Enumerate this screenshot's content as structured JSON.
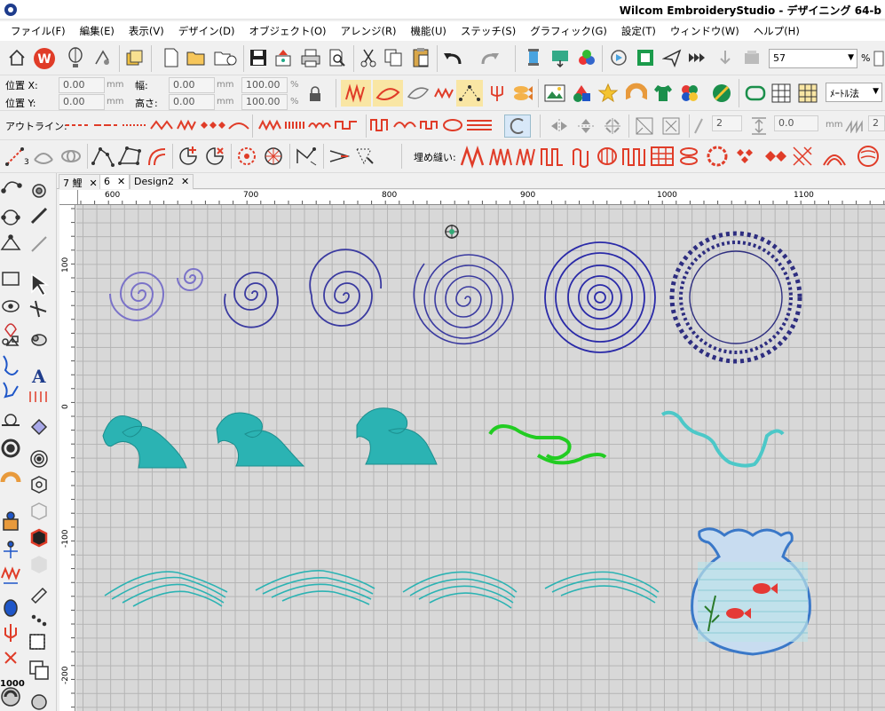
{
  "window": {
    "title": "Wilcom EmbroideryStudio - デザイニング 64-b"
  },
  "menu": [
    "ファイル(F)",
    "編集(E)",
    "表示(V)",
    "デザイン(D)",
    "オブジェクト(O)",
    "アレンジ(R)",
    "機能(U)",
    "ステッチ(S)",
    "グラフィック(G)",
    "設定(T)",
    "ウィンドウ(W)",
    "ヘルプ(H)"
  ],
  "toolbar": {
    "zoom_value": "57",
    "zoom_unit": "%",
    "measure_combo": "ﾒｰﾄﾙ法"
  },
  "position_bar": {
    "pos_x_label": "位置 X:",
    "pos_x_value": "0.00",
    "pos_x_unit": "mm",
    "pos_y_label": "位置 Y:",
    "pos_y_value": "0.00",
    "pos_y_unit": "mm",
    "width_label": "幅:",
    "width_value": "0.00",
    "width_unit": "mm",
    "height_label": "高さ:",
    "height_value": "0.00",
    "height_unit": "mm",
    "width_pct": "100.00",
    "height_pct": "100.00",
    "pct_unit": "%"
  },
  "outline_bar": {
    "label": "アウトライン:",
    "spin1": "2",
    "spin2": "0.0",
    "spin_unit": "mm",
    "spin3": "2"
  },
  "fill_bar": {
    "label": "埋め縫い:"
  },
  "tabs": [
    {
      "label": "7 鯉",
      "close": "✕"
    },
    {
      "label": "6",
      "close": "✕"
    },
    {
      "label": "Design2",
      "close": "✕"
    }
  ],
  "ruler": {
    "top": [
      "600",
      "700",
      "800",
      "900",
      "1000",
      "1100"
    ],
    "left": [
      "100",
      "0",
      "-100",
      "-200"
    ]
  },
  "icons": {
    "left_text": "1000"
  },
  "colors": {
    "spiral_light": "#7a72c8",
    "spiral_dark": "#3a3aa0",
    "teal": "#2bb3b3",
    "green": "#22cc22",
    "wilcom_red": "#e03c28",
    "accent_red": "#e53935"
  }
}
